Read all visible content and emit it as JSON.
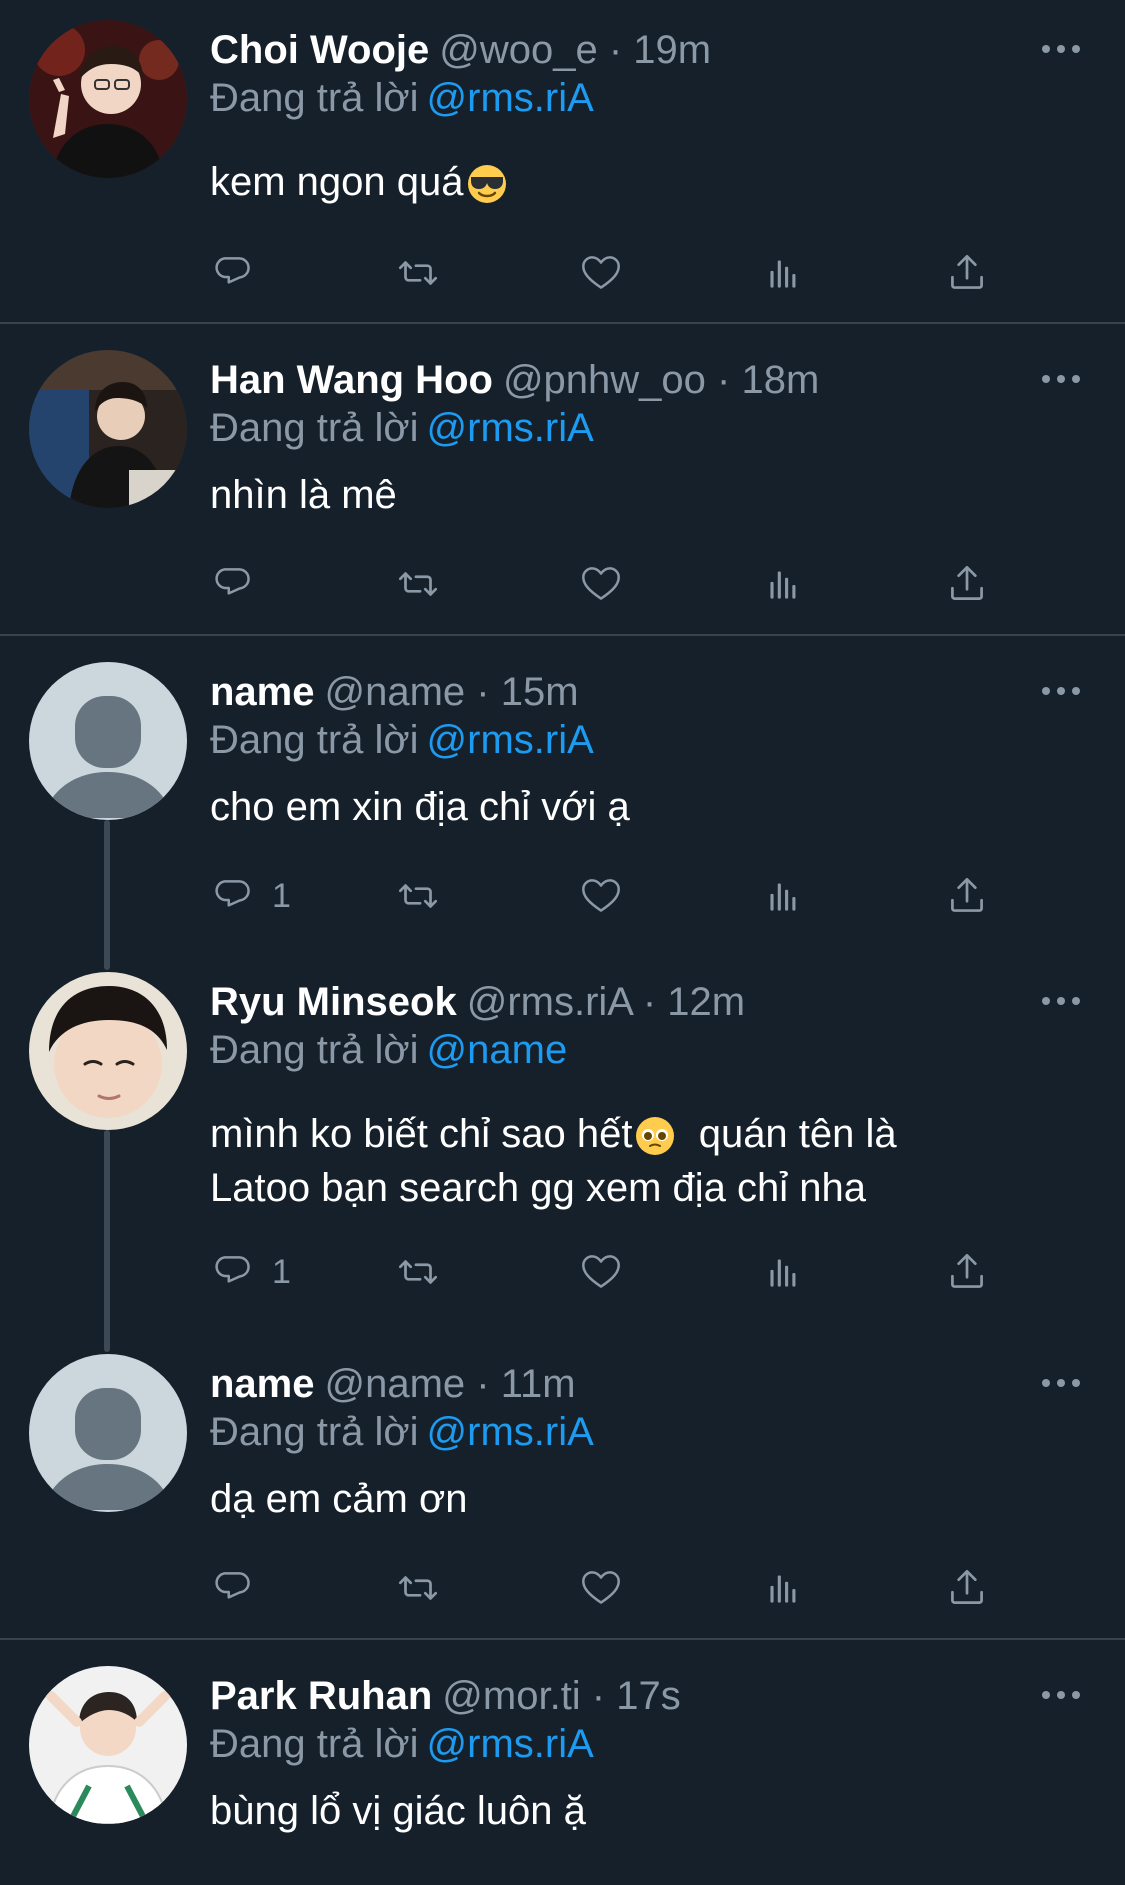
{
  "reply_prefix": "Đang trả lời",
  "colors": {
    "background": "#15202b",
    "divider": "#38444d",
    "secondary_text": "#8b98a5",
    "mention": "#1d9bf0",
    "icon": "#8b98a5",
    "thread_line": "#3d4954"
  },
  "tweets": [
    {
      "name": "Choi Wooje",
      "meta": "@woo_e · 19m",
      "reply_to": "@rms.riA",
      "text": "kem ngon quá",
      "emoji": "smiling-face-with-sunglasses",
      "reply_count": "",
      "avatar": "photo-woo-e"
    },
    {
      "name": "Han Wang Hoo",
      "meta": "@pnhw_oo · 18m",
      "reply_to": "@rms.riA",
      "text": "nhìn là mê",
      "emoji": "",
      "reply_count": "",
      "avatar": "photo-pnhw-oo"
    },
    {
      "name": "name",
      "meta": "@name · 15m",
      "reply_to": "@rms.riA",
      "text": "cho em xin địa chỉ với ạ",
      "emoji": "",
      "reply_count": "1",
      "avatar": "default-avatar"
    },
    {
      "name": "Ryu Minseok",
      "meta": "@rms.riA · 12m",
      "reply_to": "@name",
      "text_line1_a": "mình ko biết chỉ sao hết",
      "text_line1_b": "  quán tên là",
      "text_line2": "Latoo bạn search gg xem địa chỉ nha",
      "emoji": "pleading-face",
      "reply_count": "1",
      "avatar": "photo-rms-ria"
    },
    {
      "name": "name",
      "meta": "@name · 11m",
      "reply_to": "@rms.riA",
      "text": "dạ em cảm ơn",
      "emoji": "",
      "reply_count": "",
      "avatar": "default-avatar"
    },
    {
      "name": "Park Ruhan",
      "meta": "@mor.ti · 17s",
      "reply_to": "@rms.riA",
      "text": "bùng lổ vị giác luôn ặ",
      "emoji": "",
      "reply_count": "",
      "avatar": "photo-mor-ti"
    }
  ]
}
